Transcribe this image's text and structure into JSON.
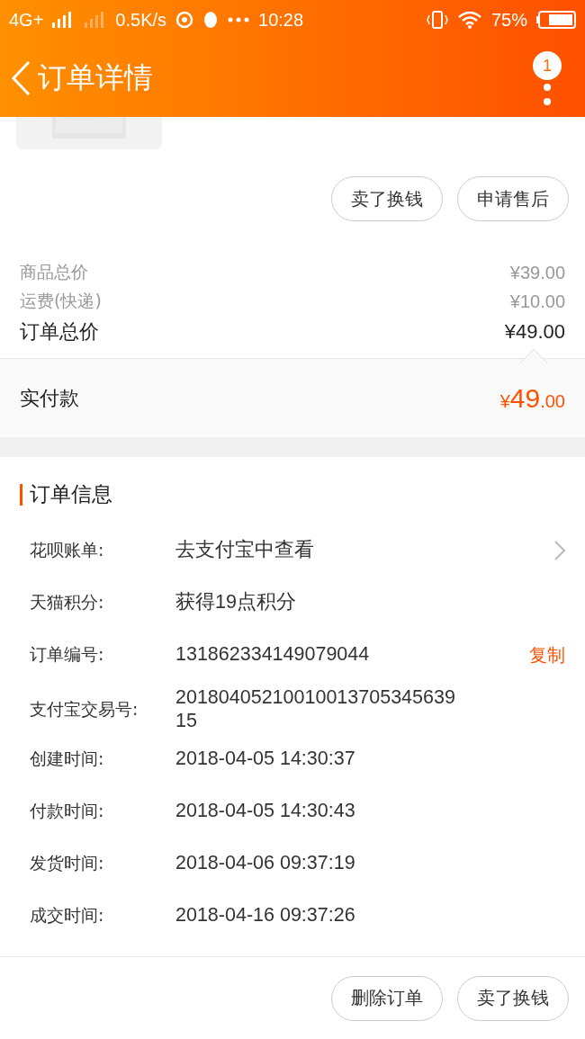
{
  "status_bar": {
    "network": "4G+",
    "speed": "0.5K/s",
    "time": "10:28",
    "battery": "75%"
  },
  "header": {
    "title": "订单详情",
    "badge": "1"
  },
  "actions_top": [
    {
      "label": "卖了换钱"
    },
    {
      "label": "申请售后"
    }
  ],
  "prices": [
    {
      "kind": "minor",
      "label": "商品总价",
      "value": "¥39.00"
    },
    {
      "kind": "minor",
      "label": "运费(快递)",
      "value": "¥10.00"
    },
    {
      "kind": "total",
      "label": "订单总价",
      "value": "¥49.00"
    }
  ],
  "paid": {
    "label": "实付款",
    "currency": "¥",
    "integer": "49",
    "decimal": ".00"
  },
  "order_info": {
    "title": "订单信息",
    "rows": [
      {
        "kind": "link",
        "label": "花呗账单:",
        "value": "去支付宝中查看"
      },
      {
        "kind": "text",
        "label": "天猫积分:",
        "value": "获得19点积分"
      },
      {
        "kind": "copy",
        "label": "订单编号:",
        "value": "131862334149079044",
        "action": "复制"
      },
      {
        "kind": "text",
        "label": "支付宝交易号:",
        "value": "2018040521001001370534563915"
      },
      {
        "kind": "text",
        "label": "创建时间:",
        "value": "2018-04-05 14:30:37"
      },
      {
        "kind": "text",
        "label": "付款时间:",
        "value": "2018-04-05 14:30:43"
      },
      {
        "kind": "text",
        "label": "发货时间:",
        "value": "2018-04-06 09:37:19"
      },
      {
        "kind": "text",
        "label": "成交时间:",
        "value": "2018-04-16 09:37:26"
      }
    ]
  },
  "actions_bottom": [
    {
      "label": "删除订单"
    },
    {
      "label": "卖了换钱"
    }
  ]
}
